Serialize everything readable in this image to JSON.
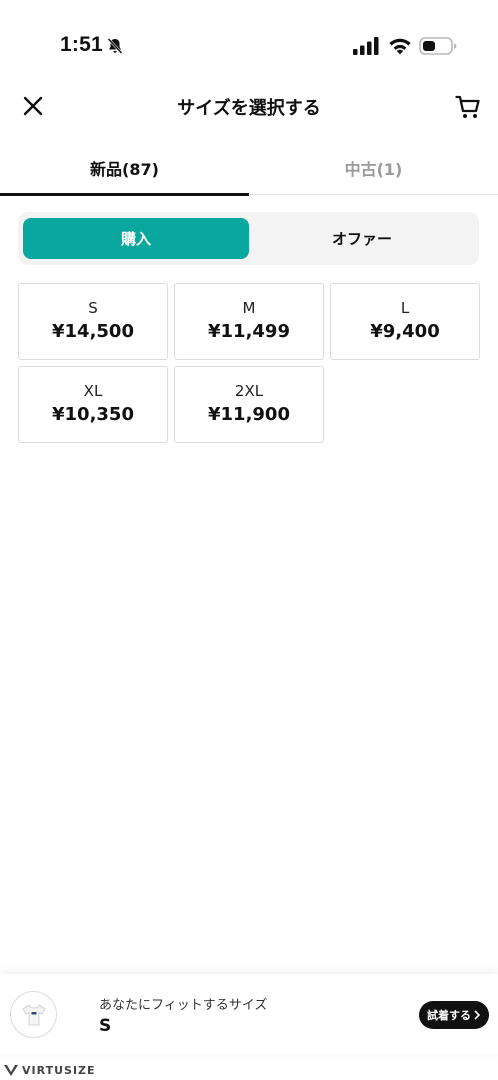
{
  "status_bar": {
    "time": "1:51",
    "icons": [
      "bell-muted-icon",
      "signal-icon",
      "wifi-icon",
      "battery-icon"
    ]
  },
  "header": {
    "title": "サイズを選択する",
    "left_icon": "close-icon",
    "right_icon": "cart-icon"
  },
  "condition_tabs": [
    {
      "label": "新品(87)",
      "active": true
    },
    {
      "label": "中古(1)",
      "active": false
    }
  ],
  "mode_toggle": {
    "buy_label": "購入",
    "offer_label": "オファー",
    "selected": "buy",
    "accent_color": "#0aa79f"
  },
  "sizes": [
    {
      "size": "S",
      "price": "¥14,500"
    },
    {
      "size": "M",
      "price": "¥11,499"
    },
    {
      "size": "L",
      "price": "¥9,400"
    },
    {
      "size": "XL",
      "price": "¥10,350"
    },
    {
      "size": "2XL",
      "price": "¥11,900"
    }
  ],
  "fit_banner": {
    "title": "あなたにフィットするサイズ",
    "recommended_size": "S",
    "button_label": "試着する",
    "logo_text": "VIRTUSIZE"
  }
}
